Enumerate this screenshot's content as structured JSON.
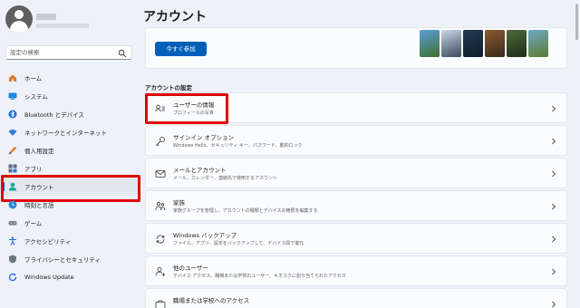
{
  "sidebar": {
    "search_placeholder": "設定の検索",
    "items": [
      {
        "label": "ホーム",
        "icon": "home-icon"
      },
      {
        "label": "システム",
        "icon": "monitor-icon"
      },
      {
        "label": "Bluetooth とデバイス",
        "icon": "bluetooth-icon"
      },
      {
        "label": "ネットワークとインターネット",
        "icon": "wifi-icon"
      },
      {
        "label": "個人用設定",
        "icon": "brush-icon"
      },
      {
        "label": "アプリ",
        "icon": "apps-icon"
      },
      {
        "label": "アカウント",
        "icon": "person-icon"
      },
      {
        "label": "時刻と言語",
        "icon": "globe-clock-icon"
      },
      {
        "label": "ゲーム",
        "icon": "gamepad-icon"
      },
      {
        "label": "アクセシビリティ",
        "icon": "accessibility-icon"
      },
      {
        "label": "プライバシーとセキュリティ",
        "icon": "shield-icon"
      },
      {
        "label": "Windows Update",
        "icon": "update-icon"
      }
    ],
    "active_index": 6
  },
  "page": {
    "title": "アカウント",
    "promo_button": "今すぐ参加",
    "section_label": "アカウントの設定"
  },
  "rows": [
    {
      "title": "ユーザーの情報",
      "desc": "プロフィールの写真",
      "icon": "user-info-icon"
    },
    {
      "title": "サインイン オプション",
      "desc": "Windows Hello、セキュリティ キー、パスワード、動的ロック",
      "icon": "key-icon"
    },
    {
      "title": "メールとアカウント",
      "desc": "メール、カレンダー、連絡先で使用するアカウント",
      "icon": "mail-icon"
    },
    {
      "title": "家族",
      "desc": "家族グループを管理し、アカウントの種類とデバイスの権限を編集する",
      "icon": "family-icon"
    },
    {
      "title": "Windows バックアップ",
      "desc": "ファイル、アプリ、設定をバックアップして、デバイス間で復元",
      "icon": "backup-icon"
    },
    {
      "title": "他のユーザー",
      "desc": "デバイス アクセス、職場または学校のユーザー、キオスクに割り当てられたアクセス",
      "icon": "other-users-icon"
    },
    {
      "title": "職場または学校へのアクセス",
      "desc": "",
      "icon": "briefcase-icon"
    }
  ],
  "colors": {
    "accent": "#005fb8",
    "highlight": "#e00000",
    "background": "#eef2f8"
  }
}
